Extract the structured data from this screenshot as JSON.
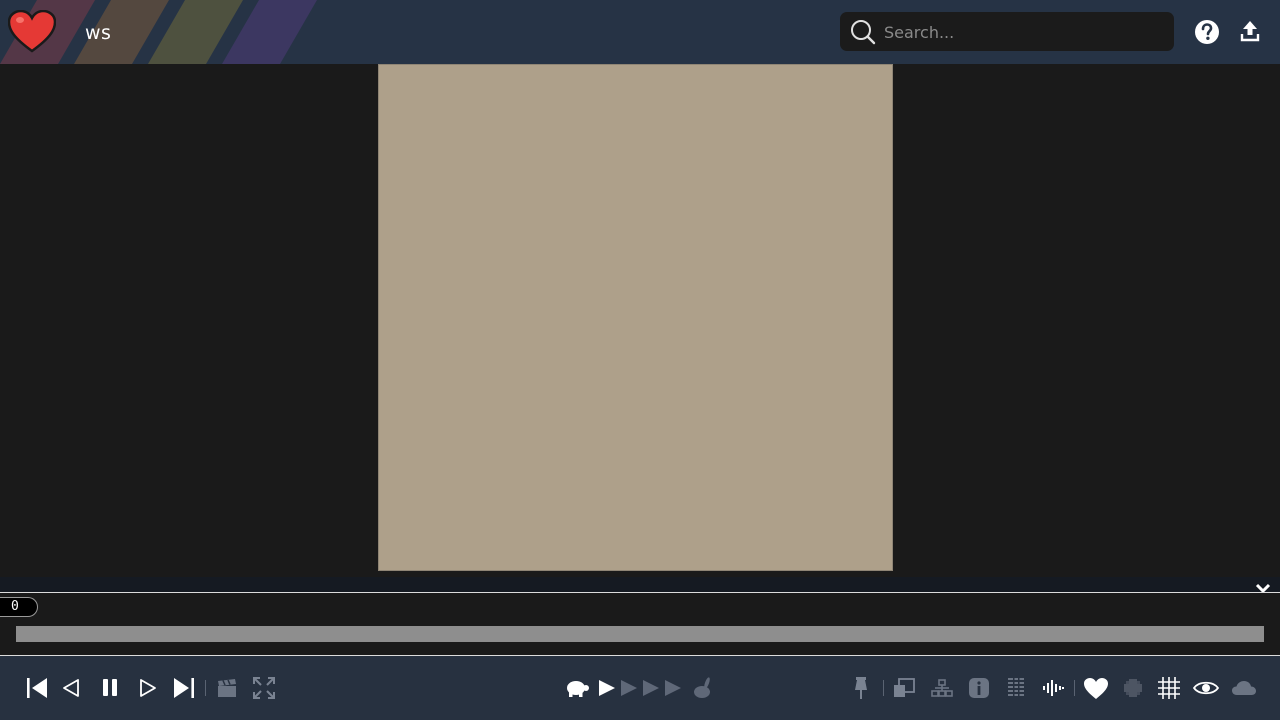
{
  "header": {
    "title": "ws",
    "search": {
      "placeholder": "Search...",
      "value": ""
    },
    "icons": [
      "heart-logo-icon",
      "search-icon",
      "help-icon",
      "upload-icon"
    ]
  },
  "timeline": {
    "frame": "0",
    "progress": 0
  },
  "toolbar": {
    "playback": [
      "first-frame-icon",
      "step-back-icon",
      "pause-icon",
      "step-forward-icon",
      "last-frame-icon",
      "clapperboard-icon",
      "fullscreen-icon"
    ],
    "speed": [
      "turtle-icon",
      "speed-1-icon",
      "speed-2-icon",
      "speed-3-icon",
      "speed-4-icon",
      "rabbit-icon"
    ],
    "tools": [
      "pin-icon",
      "onion-skin-icon",
      "hierarchy-icon",
      "info-icon",
      "table-icon",
      "audio-wave-icon",
      "heart-icon",
      "blur-icon",
      "grid-icon",
      "eye-icon",
      "cloud-icon"
    ]
  },
  "colors": {
    "header_bg": "#263345",
    "viewer_bg": "#1a1a1a",
    "canvas_bg": "#aea08a",
    "toolbar_bg": "#273140",
    "scrubber": "#8e8e8e",
    "heart": "#e53935"
  }
}
